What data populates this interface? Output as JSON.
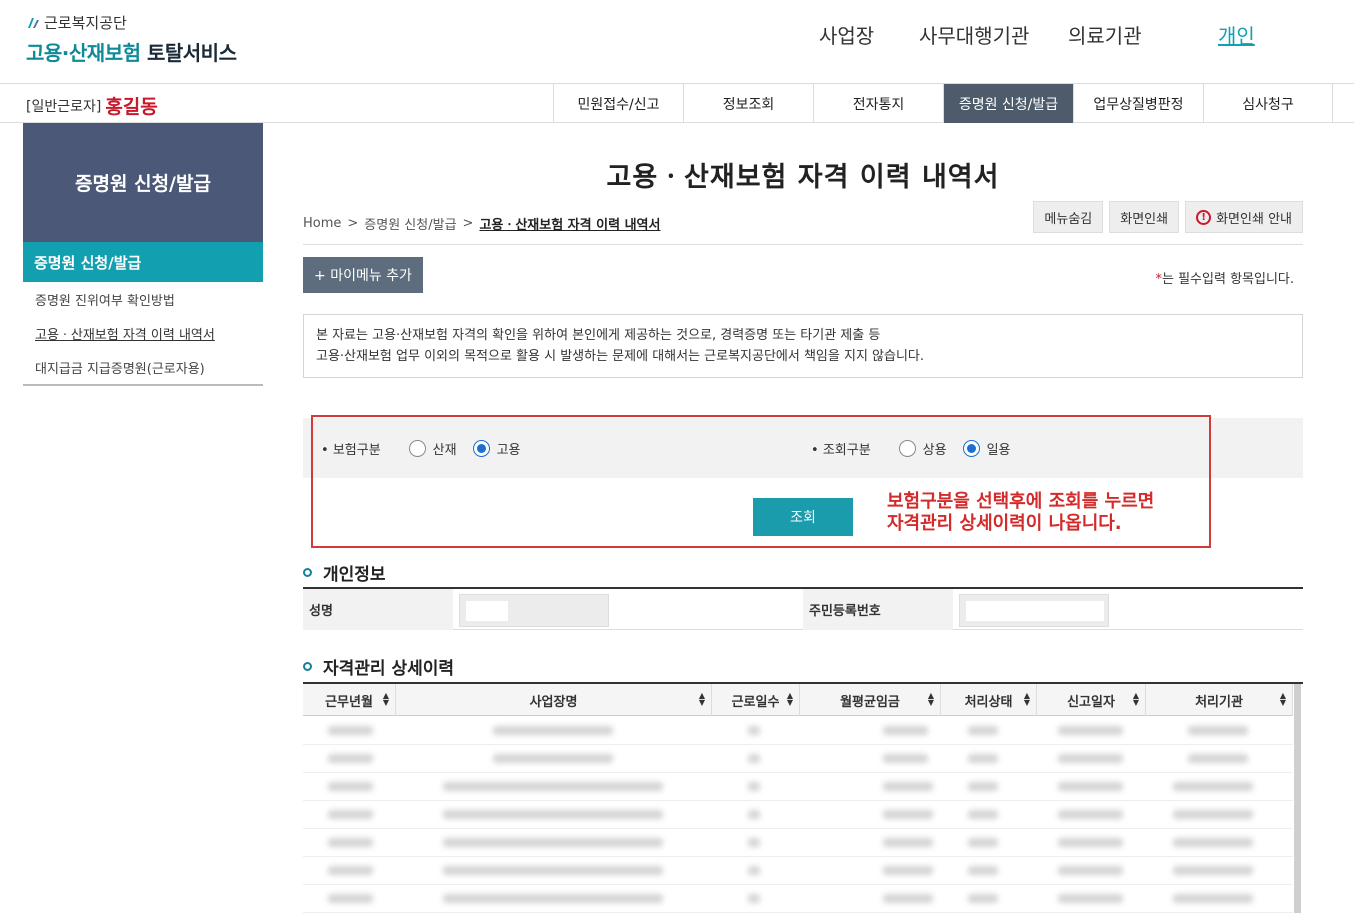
{
  "header": {
    "agency": "근로복지공단",
    "service_part1": "고용·산재보험",
    "service_part2": "토탈서비스",
    "nav": [
      "사업장",
      "사무대행기관",
      "의료기관",
      "개인"
    ]
  },
  "topbar": {
    "user_type": "[일반근로자]",
    "user_name": "홍길동",
    "tabs": [
      "민원접수/신고",
      "정보조회",
      "전자통지",
      "증명원 신청/발급",
      "업무상질병판정",
      "심사청구"
    ]
  },
  "sidebar": {
    "title": "증명원 신청/발급",
    "selected": "증명원 신청/발급",
    "items": [
      "증명원 진위여부 확인방법",
      "고용ㆍ산재보험 자격 이력 내역서",
      "대지급금 지급증명원(근로자용)"
    ]
  },
  "main": {
    "title": "고용ㆍ산재보험 자격 이력 내역서",
    "breadcrumb": [
      "Home",
      "증명원 신청/발급",
      "고용ㆍ산재보험 자격 이력 내역서"
    ],
    "breadcrumb_sep": ">",
    "util_buttons": [
      "메뉴숨김",
      "화면인쇄",
      "화면인쇄 안내"
    ],
    "add_mymenu": "+ 마이메뉴 추가",
    "required_note_star": "*",
    "required_note": "는 필수입력 항목입니다.",
    "notice_lines": [
      "본 자료는 고용·산재보험 자격의 확인을 위하여 본인에게 제공하는 것으로, 경력증명 또는 타기관 제출 등",
      "고용·산재보험 업무 이외의 목적으로 활용 시 발생하는 문제에 대해서는 근로복지공단에서 책임을 지지 않습니다."
    ]
  },
  "search": {
    "insurance_label": "보험구분",
    "insurance_options": [
      "산재",
      "고용"
    ],
    "insurance_selected": "고용",
    "query_label": "조회구분",
    "query_options": [
      "상용",
      "일용"
    ],
    "query_selected": "일용",
    "button": "조회",
    "guide_line1": "보험구분을 선택후에 조회를 누르면",
    "guide_line2": "자격관리 상세이력이 나옵니다."
  },
  "personal": {
    "section_title": "개인정보",
    "name_label": "성명",
    "rrn_label": "주민등록번호"
  },
  "history": {
    "section_title": "자격관리 상세이력",
    "columns": [
      "근무년월",
      "사업장명",
      "근로일수",
      "월평균임금",
      "처리상태",
      "신고일자",
      "처리기관"
    ],
    "sort_glyph_up": "▲",
    "sort_glyph_down": "▼"
  }
}
